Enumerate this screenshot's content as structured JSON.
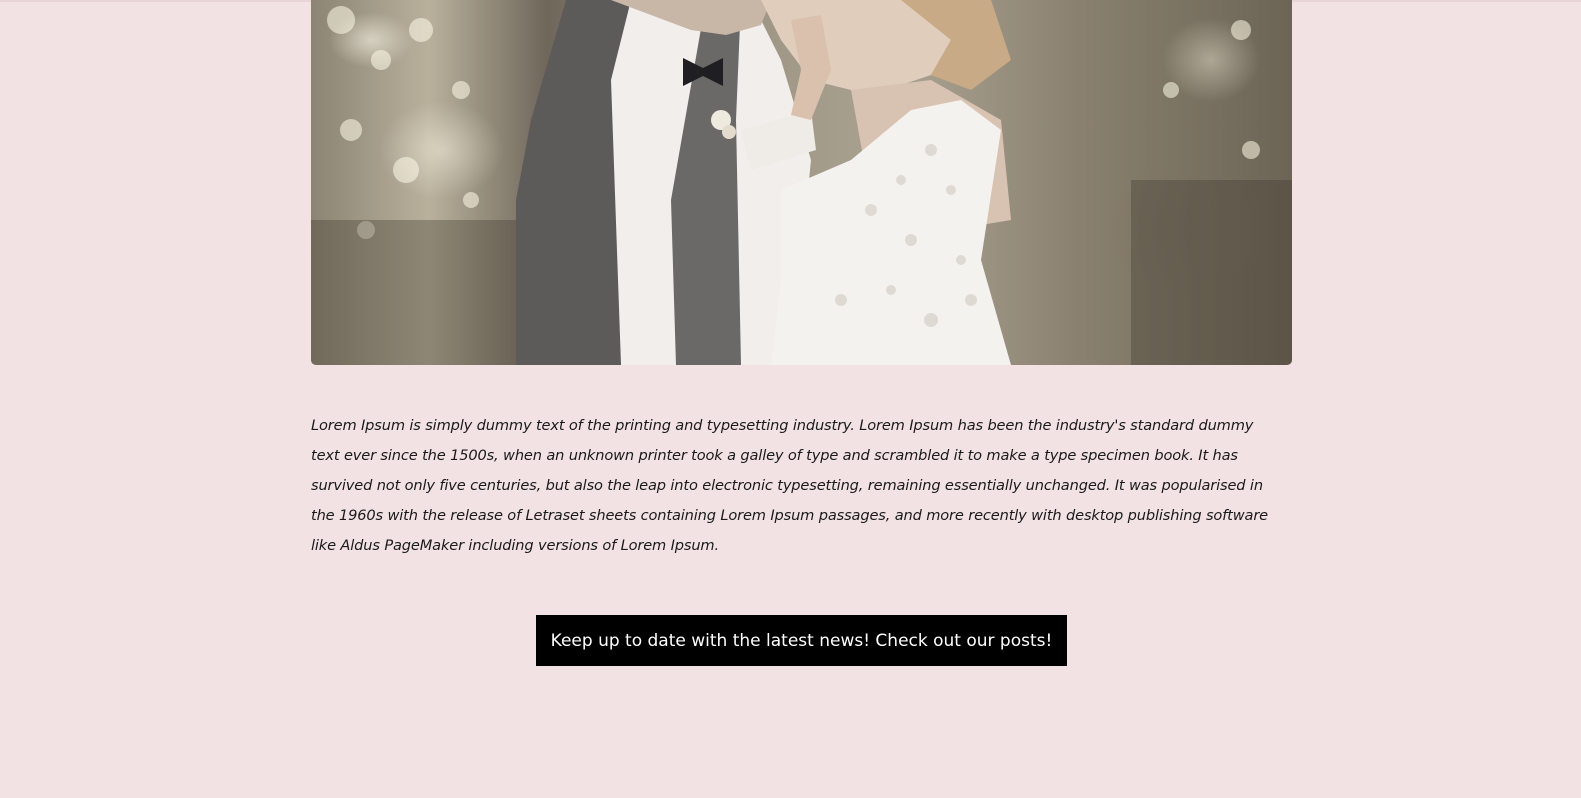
{
  "page": {
    "background_color": "#f2e2e3"
  },
  "hero_image": {
    "icon": "wedding-couple-photo"
  },
  "article": {
    "body": "Lorem Ipsum is simply dummy text of the printing and typesetting industry. Lorem Ipsum has been the industry's standard dummy text ever since the 1500s, when an unknown printer took a galley of type and scrambled it to make a type specimen book. It has survived not only five centuries, but also the leap into electronic typesetting, remaining essentially unchanged. It was popularised in the 1960s with the release of Letraset sheets containing Lorem Ipsum passages, and more recently with desktop publishing software like Aldus PageMaker including versions of Lorem Ipsum."
  },
  "cta": {
    "label": "Keep up to date with the latest news! Check out our posts!",
    "background_color": "#000000",
    "text_color": "#ffffff"
  }
}
